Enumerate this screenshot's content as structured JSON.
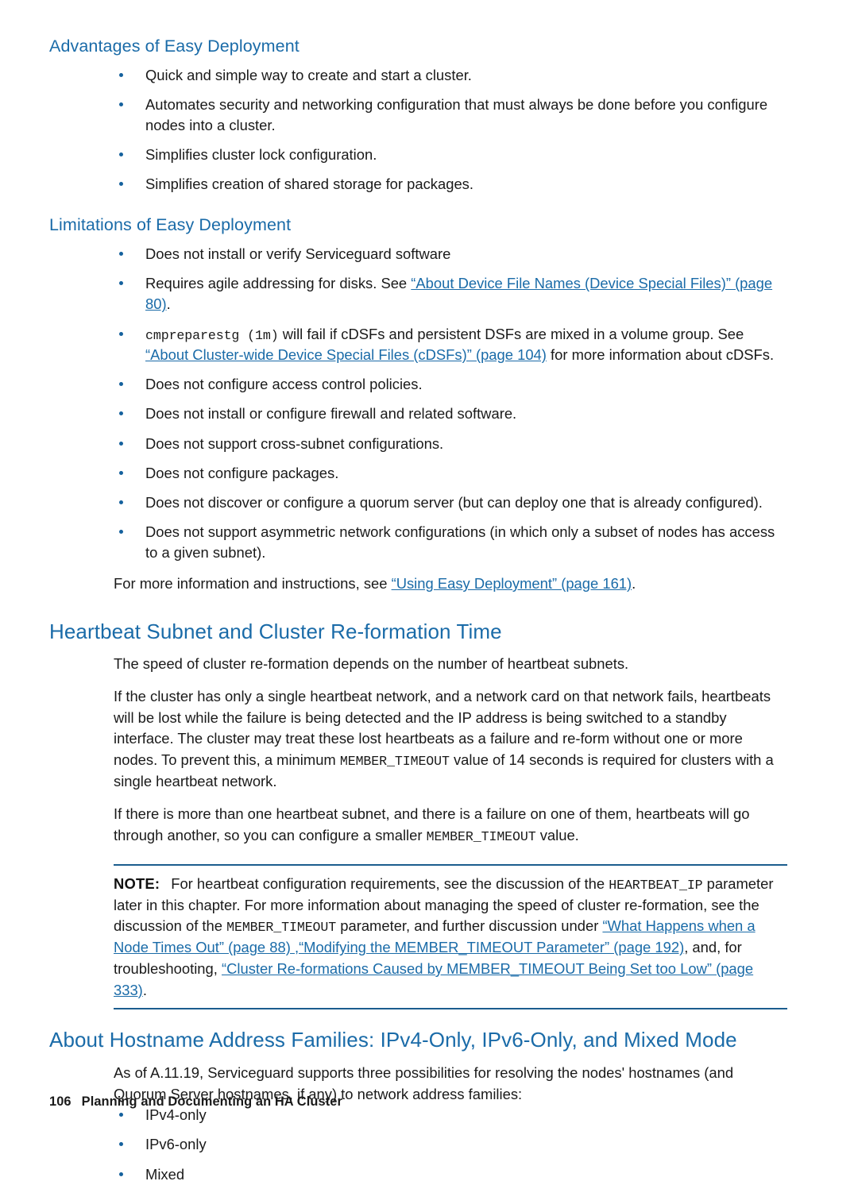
{
  "page": {
    "number": "106",
    "footer_title": "Planning and Documenting an HA Cluster"
  },
  "sections": {
    "advantages": {
      "heading": "Advantages of Easy Deployment",
      "bullets": [
        "Quick and simple way to create and start a cluster.",
        "Automates security and networking configuration that must always be done before you configure nodes into a cluster.",
        "Simplifies cluster lock configuration.",
        "Simplifies creation of shared storage for packages."
      ]
    },
    "limitations": {
      "heading": "Limitations of Easy Deployment",
      "bullet1": "Does not install or verify Serviceguard software",
      "bullet2": {
        "lead": "Requires agile addressing for disks. See ",
        "link": "“About Device File Names (Device Special Files)” (page 80)",
        "tail": "."
      },
      "bullet3": {
        "code": "cmpreparestg (1m)",
        "text1": " will fail if cDSFs and persistent DSFs are mixed in a volume group. See ",
        "link": "“About Cluster-wide Device Special Files (cDSFs)” (page 104)",
        "text2": " for more information about cDSFs."
      },
      "bullet4": "Does not configure access control policies.",
      "bullet5": "Does not install or configure firewall and related software.",
      "bullet6": "Does not support cross-subnet configurations.",
      "bullet7": "Does not configure packages.",
      "bullet8": "Does not discover or configure a quorum server (but can deploy one that is already configured).",
      "bullet9": "Does not support asymmetric network configurations (in which only a subset of nodes has access to a given subnet).",
      "tail": {
        "lead": "For more information and instructions, see ",
        "link": "“Using Easy Deployment” (page 161)",
        "end": "."
      }
    },
    "heartbeat": {
      "heading": "Heartbeat Subnet and Cluster Re-formation Time",
      "para1": "The speed of cluster re-formation depends on the number of heartbeat subnets.",
      "para2": {
        "text1": "If the cluster has only a single heartbeat network, and a network card on that network fails, heartbeats will be lost while the failure is being detected and the IP address is being switched to a standby interface. The cluster may treat these lost heartbeats as a failure and re-form without one or more nodes. To prevent this, a minimum ",
        "code": "MEMBER_TIMEOUT",
        "text2": " value of 14 seconds is required for clusters with a single heartbeat network."
      },
      "para3": {
        "text1": "If there is more than one heartbeat subnet, and there is a failure on one of them, heartbeats will go through another, so you can configure a smaller ",
        "code": "MEMBER_TIMEOUT",
        "text2": " value."
      },
      "note": {
        "label": "NOTE:",
        "text1": "For heartbeat configuration requirements, see the discussion of the ",
        "code1": "HEARTBEAT_IP",
        "text2": " parameter later in this chapter. For more information about managing the speed of cluster re-formation, see the discussion of the ",
        "code2": "MEMBER_TIMEOUT",
        "text3": " parameter, and further discussion under ",
        "link1": "“What Happens when a Node Times Out” (page 88) ",
        "link2": ",“Modifying the MEMBER_TIMEOUT Parameter” (page 192)",
        "text4": ", and, for troubleshooting, ",
        "link3": "“Cluster Re-formations Caused by MEMBER_TIMEOUT Being Set too Low” (page 333)",
        "text5": "."
      }
    },
    "hostname": {
      "heading": "About Hostname Address Families: IPv4-Only, IPv6-Only, and Mixed Mode",
      "para1": "As of A.11.19, Serviceguard supports three possibilities for resolving the nodes' hostnames (and Quorum Server hostnames, if any) to network address families:",
      "bullets": [
        "IPv4-only",
        "IPv6-only",
        "Mixed"
      ]
    }
  },
  "colors": {
    "heading_blue": "#1a6ba8",
    "link_blue": "#1a6ba8",
    "bullet_blue": "#15619d",
    "rule_blue": "#1b5d8e",
    "body_text": "#1a1a1a"
  }
}
